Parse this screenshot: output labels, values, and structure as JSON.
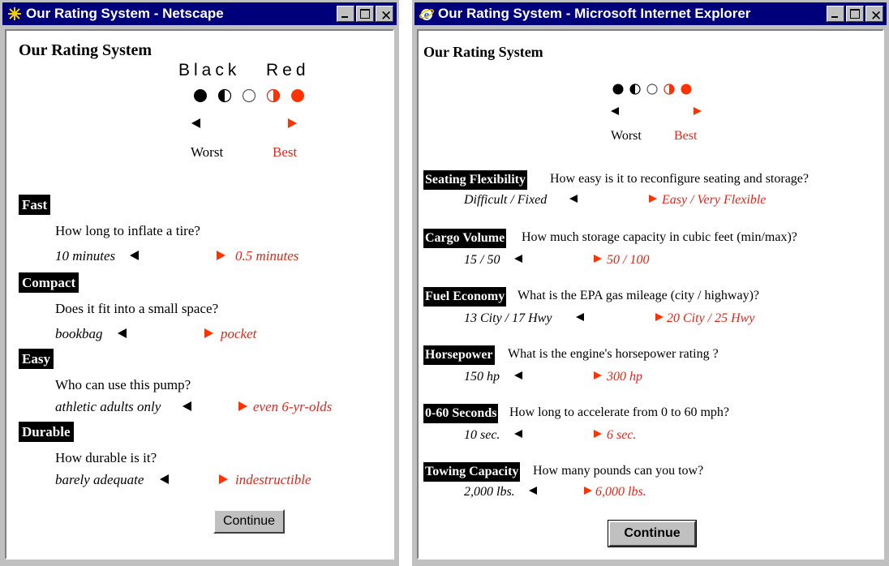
{
  "colors": {
    "title_bar": "#00007b",
    "accent_red": "#e0261a",
    "black": "#000000"
  },
  "netscape": {
    "window_title": "Our Rating System - Netscape",
    "app_icon": "netscape-icon",
    "heading": "Our Rating System",
    "legend": {
      "black_label": "Black",
      "red_label": "Red",
      "worst": "Worst",
      "best": "Best"
    },
    "items": [
      {
        "tag": "Fast",
        "question": "How long to inflate a tire?",
        "worst": "10 minutes",
        "best": "0.5 minutes"
      },
      {
        "tag": "Compact",
        "question": "Does it fit into a small space?",
        "worst": "bookbag",
        "best": "pocket"
      },
      {
        "tag": "Easy",
        "question": "Who can use this pump?",
        "worst": "athletic adults only",
        "best": "even 6-yr-olds"
      },
      {
        "tag": "Durable",
        "question": "How durable is it?",
        "worst": "barely adequate",
        "best": "indestructible"
      }
    ],
    "continue_label": "Continue"
  },
  "ie": {
    "window_title": "Our Rating System - Microsoft Internet Explorer",
    "app_icon": "internet-explorer-icon",
    "heading": "Our Rating System",
    "legend": {
      "worst": "Worst",
      "best": "Best"
    },
    "items": [
      {
        "tag": "Seating Flexibility",
        "question": "How easy is it to reconfigure seating and storage?",
        "worst": "Difficult / Fixed",
        "best": "Easy / Very Flexible"
      },
      {
        "tag": "Cargo Volume",
        "question": "How much storage capacity in cubic feet (min/max)?",
        "worst": "15 / 50",
        "best": "50 / 100"
      },
      {
        "tag": "Fuel Economy",
        "question": "What is the EPA gas mileage (city / highway)?",
        "worst": "13 City / 17 Hwy",
        "best": "20 City / 25 Hwy"
      },
      {
        "tag": "Horsepower",
        "question": "What is the engine's horsepower rating ?",
        "worst": "150 hp",
        "best": "300 hp"
      },
      {
        "tag": "0-60 Seconds",
        "question": "How long to accelerate from 0 to 60 mph?",
        "worst": "10 sec.",
        "best": "6 sec."
      },
      {
        "tag": "Towing Capacity",
        "question": "How many pounds can you tow?",
        "worst": "2,000 lbs.",
        "best": "6,000 lbs."
      }
    ],
    "continue_label": "Continue"
  }
}
